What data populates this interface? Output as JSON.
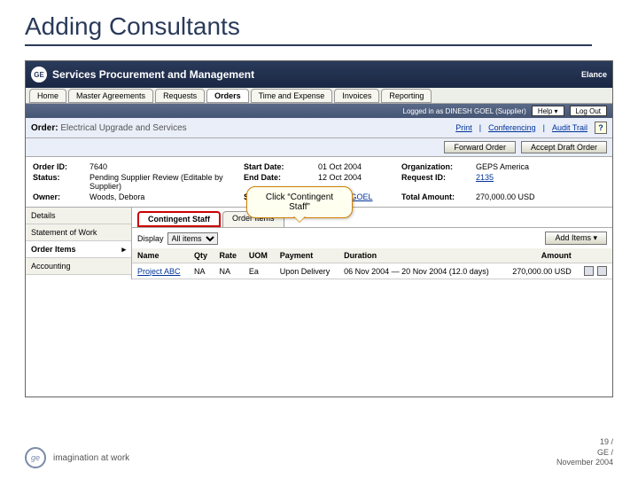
{
  "slide": {
    "title": "Adding Consultants"
  },
  "brand": {
    "logo": "GE",
    "title": "Services Procurement and Management",
    "vendor": "Elance"
  },
  "nav": {
    "tabs": [
      "Home",
      "Master Agreements",
      "Requests",
      "Orders",
      "Time and Expense",
      "Invoices",
      "Reporting"
    ],
    "active_index": 3
  },
  "login": {
    "text": "Logged in as DINESH GOEL (Supplier)",
    "help": "Help",
    "logout": "Log Out"
  },
  "order_header": {
    "label": "Order:",
    "title": "Electrical Upgrade and Services",
    "links": {
      "print": "Print",
      "conferencing": "Conferencing",
      "audit": "Audit Trail"
    }
  },
  "actions": {
    "forward": "Forward Order",
    "accept": "Accept Draft Order"
  },
  "details": {
    "order_id_lbl": "Order ID:",
    "order_id": "7640",
    "status_lbl": "Status:",
    "status": "Pending Supplier Review (Editable by Supplier)",
    "owner_lbl": "Owner:",
    "owner": "Woods, Debora",
    "start_lbl": "Start Date:",
    "start": "01 Oct 2004",
    "end_lbl": "End Date:",
    "end": "12 Oct 2004",
    "contact_lbl": "Supplier Contact:",
    "contact": "DINESH GOEL",
    "org_lbl": "Organization:",
    "org": "GEPS America",
    "req_lbl": "Request ID:",
    "req": "2135",
    "total_lbl": "Total Amount:",
    "total": "270,000.00 USD"
  },
  "sidebar": {
    "items": [
      "Details",
      "Statement of Work",
      "Order Items",
      "Accounting"
    ],
    "active_index": 2
  },
  "subtabs": {
    "items": [
      "Contingent Staff",
      "Order Items"
    ],
    "highlight_index": 0
  },
  "toolbar": {
    "display_lbl": "Display",
    "display_value": "All items",
    "add_items": "Add Items"
  },
  "table": {
    "headers": [
      "Name",
      "Qty",
      "Rate",
      "UOM",
      "Payment",
      "Duration",
      "Amount",
      ""
    ],
    "rows": [
      {
        "name": "Project ABC",
        "qty": "NA",
        "rate": "NA",
        "uom": "Ea",
        "payment": "Upon Delivery",
        "duration": "06 Nov 2004 — 20 Nov 2004 (12.0 days)",
        "amount": "270,000.00 USD"
      }
    ]
  },
  "callout": {
    "prefix": "Click “",
    "name": "Contingent Staff",
    "suffix": "”"
  },
  "footer": {
    "tagline": "imagination at work",
    "page": "19 /",
    "company": "GE /",
    "date": "November 2004"
  }
}
